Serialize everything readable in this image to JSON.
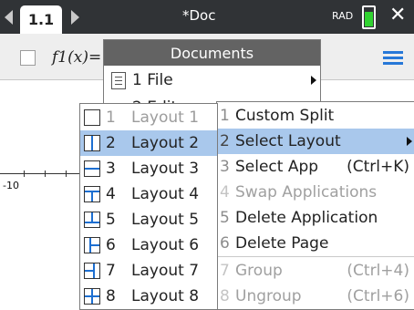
{
  "titlebar": {
    "tab_label": "1.1",
    "doc_title": "*Doc",
    "angle_mode": "RAD",
    "colors": {
      "bar": "#303336",
      "battery": "#31d331"
    }
  },
  "toolbar": {
    "function_label": "f1(x)="
  },
  "graph": {
    "x_tick_label": "-10"
  },
  "documents_menu": {
    "header": "Documents",
    "items": [
      {
        "number": "1",
        "label": "File"
      },
      {
        "number": "2",
        "label": "Edit"
      }
    ]
  },
  "layout_menu": {
    "highlight_color": "#a9c8ec",
    "items": [
      {
        "number": "1",
        "label": "Layout 1",
        "icon": "layout-1-icon",
        "disabled": true
      },
      {
        "number": "2",
        "label": "Layout 2",
        "icon": "layout-2-icon",
        "selected": true
      },
      {
        "number": "3",
        "label": "Layout 3",
        "icon": "layout-3-icon"
      },
      {
        "number": "4",
        "label": "Layout 4",
        "icon": "layout-4-icon"
      },
      {
        "number": "5",
        "label": "Layout 5",
        "icon": "layout-5-icon"
      },
      {
        "number": "6",
        "label": "Layout 6",
        "icon": "layout-6-icon"
      },
      {
        "number": "7",
        "label": "Layout 7",
        "icon": "layout-7-icon"
      },
      {
        "number": "8",
        "label": "Layout 8",
        "icon": "layout-8-icon"
      }
    ]
  },
  "page_layout_menu": {
    "items": [
      {
        "number": "1",
        "label": "Custom Split",
        "shortcut": ""
      },
      {
        "number": "2",
        "label": "Select Layout",
        "shortcut": "",
        "highlighted": true,
        "has_submenu": true
      },
      {
        "number": "3",
        "label": "Select App",
        "shortcut": "(Ctrl+K)"
      },
      {
        "number": "4",
        "label": "Swap Applications",
        "shortcut": "",
        "disabled": true
      },
      {
        "number": "5",
        "label": "Delete Application",
        "shortcut": ""
      },
      {
        "number": "6",
        "label": "Delete Page",
        "shortcut": ""
      },
      {
        "number": "7",
        "label": "Group",
        "shortcut": "(Ctrl+4)",
        "disabled": true
      },
      {
        "number": "8",
        "label": "Ungroup",
        "shortcut": "(Ctrl+6)",
        "disabled": true
      }
    ]
  }
}
